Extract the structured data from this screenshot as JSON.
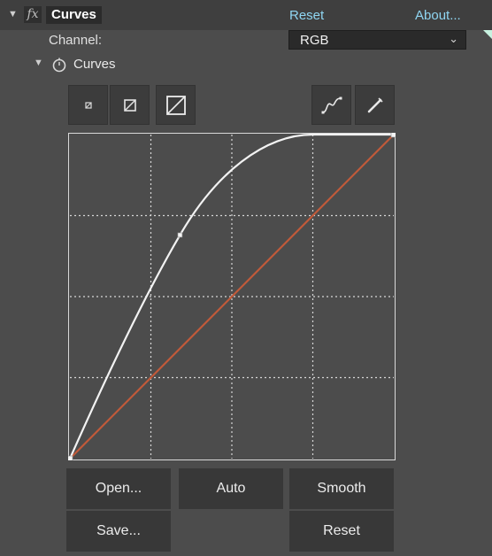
{
  "header": {
    "effect_name": "Curves",
    "fx_label": "fx",
    "reset_label": "Reset",
    "about_label": "About..."
  },
  "channel": {
    "label": "Channel:",
    "selected": "RGB"
  },
  "section": {
    "title": "Curves"
  },
  "toolbar": {
    "tools": [
      "graph-size-small-icon",
      "graph-size-medium-icon",
      "graph-size-large-icon",
      "bezier-curve-icon",
      "pencil-icon"
    ]
  },
  "curve": {
    "guide_color": "#c05a3a",
    "curve_color": "#f2f2f2",
    "grid_divisions": 4,
    "control_points": [
      [
        0,
        0
      ],
      [
        0.34,
        0.69
      ],
      [
        1,
        1
      ]
    ]
  },
  "buttons": {
    "open": "Open...",
    "auto": "Auto",
    "smooth": "Smooth",
    "save": "Save...",
    "reset": "Reset"
  }
}
